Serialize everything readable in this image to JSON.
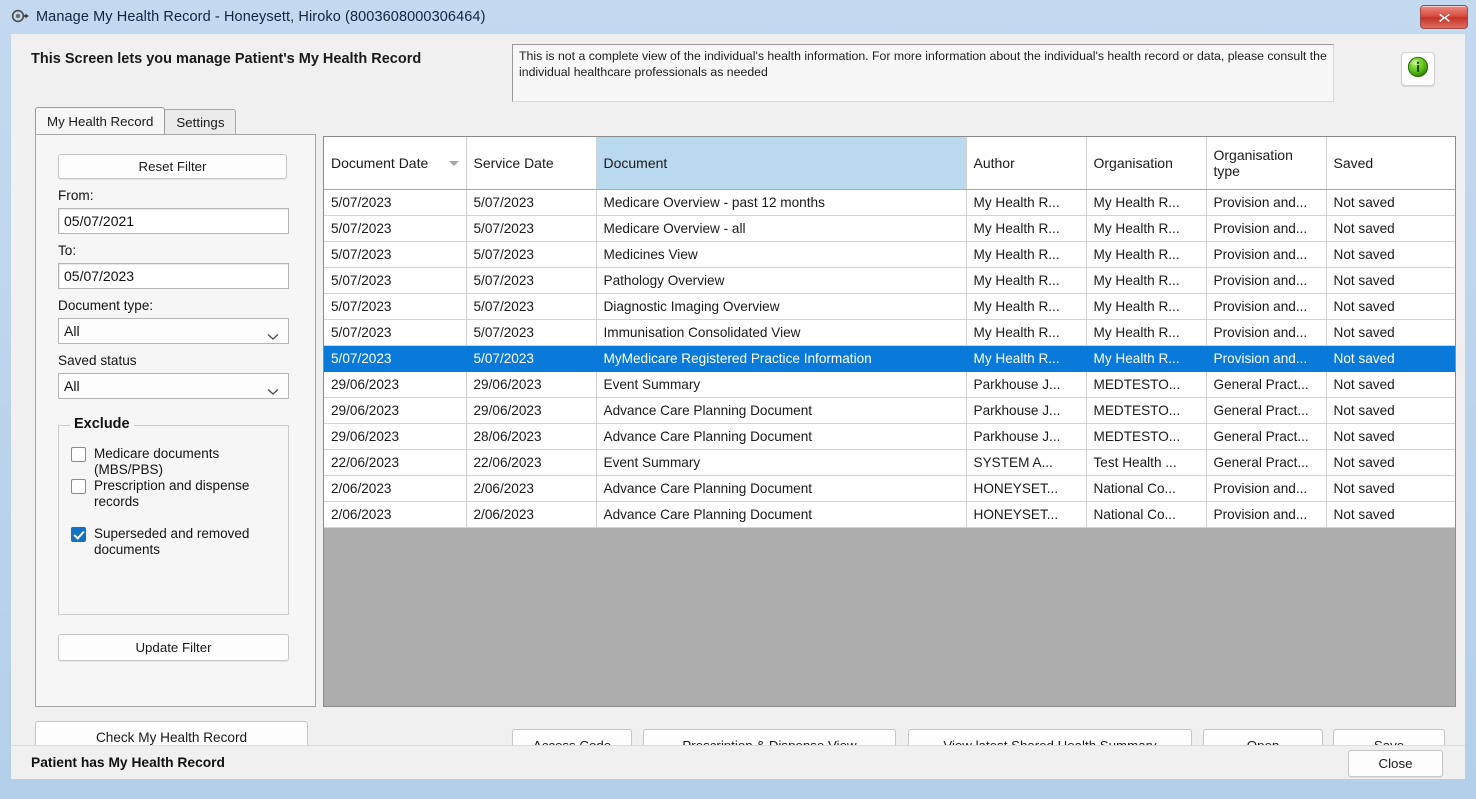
{
  "window": {
    "title": "Manage My Health Record - Honeysett, Hiroko (8003608000306464)",
    "icon": "record-scope-icon",
    "close_icon": "close-icon"
  },
  "header": {
    "headline": "This Screen lets you manage Patient's My Health Record",
    "disclaimer": "This is not a complete view of the individual's health information. For more information about the individual's health record or data, please consult the individual healthcare professionals as needed",
    "info_icon": "info-icon"
  },
  "tabs": [
    {
      "label": "My Health Record",
      "active": true
    },
    {
      "label": "Settings",
      "active": false
    }
  ],
  "filter": {
    "reset_label": "Reset Filter",
    "from_label": "From:",
    "from_value": "05/07/2021",
    "to_label": "To:",
    "to_value": "05/07/2023",
    "doctype_label": "Document type:",
    "doctype_value": "All",
    "saved_status_label": "Saved status",
    "saved_status_value": "All",
    "exclude_legend": "Exclude",
    "exclude_items": [
      {
        "label": "Medicare documents (MBS/PBS)",
        "checked": false
      },
      {
        "label": "Prescription and dispense records",
        "checked": false
      },
      {
        "label": "Superseded and removed documents",
        "checked": true
      }
    ],
    "update_label": "Update Filter",
    "check_mhr_label": "Check My Health Record"
  },
  "grid": {
    "columns": [
      {
        "label": "Document Date",
        "sorted": true,
        "highlight": false
      },
      {
        "label": "Service Date",
        "sorted": false,
        "highlight": false
      },
      {
        "label": "Document",
        "sorted": false,
        "highlight": true
      },
      {
        "label": "Author",
        "sorted": false,
        "highlight": false
      },
      {
        "label": "Organisation",
        "sorted": false,
        "highlight": false
      },
      {
        "label": "Organisation type",
        "sorted": false,
        "highlight": false
      },
      {
        "label": "Saved",
        "sorted": false,
        "highlight": false
      }
    ],
    "rows": [
      {
        "selected": false,
        "cells": [
          "5/07/2023",
          "5/07/2023",
          "Medicare Overview - past 12 months",
          "My Health R...",
          "My Health R...",
          "Provision and...",
          "Not saved"
        ]
      },
      {
        "selected": false,
        "cells": [
          "5/07/2023",
          "5/07/2023",
          "Medicare Overview - all",
          "My Health R...",
          "My Health R...",
          "Provision and...",
          "Not saved"
        ]
      },
      {
        "selected": false,
        "cells": [
          "5/07/2023",
          "5/07/2023",
          "Medicines View",
          "My Health R...",
          "My Health R...",
          "Provision and...",
          "Not saved"
        ]
      },
      {
        "selected": false,
        "cells": [
          "5/07/2023",
          "5/07/2023",
          "Pathology Overview",
          "My Health R...",
          "My Health R...",
          "Provision and...",
          "Not saved"
        ]
      },
      {
        "selected": false,
        "cells": [
          "5/07/2023",
          "5/07/2023",
          "Diagnostic Imaging Overview",
          "My Health R...",
          "My Health R...",
          "Provision and...",
          "Not saved"
        ]
      },
      {
        "selected": false,
        "cells": [
          "5/07/2023",
          "5/07/2023",
          "Immunisation Consolidated View",
          "My Health R...",
          "My Health R...",
          "Provision and...",
          "Not saved"
        ]
      },
      {
        "selected": true,
        "cells": [
          "5/07/2023",
          "5/07/2023",
          "MyMedicare Registered Practice Information",
          "My Health R...",
          "My Health R...",
          "Provision and...",
          "Not saved"
        ]
      },
      {
        "selected": false,
        "cells": [
          "29/06/2023",
          "29/06/2023",
          "Event Summary",
          "Parkhouse J...",
          "MEDTESTO...",
          "General Pract...",
          "Not saved"
        ]
      },
      {
        "selected": false,
        "cells": [
          "29/06/2023",
          "29/06/2023",
          "Advance Care Planning Document",
          "Parkhouse J...",
          "MEDTESTO...",
          "General Pract...",
          "Not saved"
        ]
      },
      {
        "selected": false,
        "cells": [
          "29/06/2023",
          "28/06/2023",
          "Advance Care Planning Document",
          "Parkhouse J...",
          "MEDTESTO...",
          "General Pract...",
          "Not saved"
        ]
      },
      {
        "selected": false,
        "cells": [
          "22/06/2023",
          "22/06/2023",
          "Event Summary",
          "SYSTEM A...",
          "Test Health ...",
          "General Pract...",
          "Not saved"
        ]
      },
      {
        "selected": false,
        "cells": [
          "2/06/2023",
          "2/06/2023",
          "Advance Care Planning Document",
          "HONEYSET...",
          "National Co...",
          "Provision and...",
          "Not saved"
        ]
      },
      {
        "selected": false,
        "cells": [
          "2/06/2023",
          "2/06/2023",
          "Advance Care Planning Document",
          "HONEYSET...",
          "National Co...",
          "Provision and...",
          "Not saved"
        ]
      }
    ]
  },
  "actions": {
    "access_code": "Access Code",
    "prescription_dispense_view": "Prescription & Dispense View",
    "view_latest_shs": "View latest Shared Health Summary",
    "open": "Open",
    "save": "Save"
  },
  "statusbar": {
    "text": "Patient has My Health Record",
    "close_label": "Close"
  },
  "colors": {
    "selection_blue": "#0a7ada",
    "column_highlight": "#b9d9ee",
    "checkbox_checked": "#1173c4",
    "grid_empty": "#adadad",
    "window_chrome": "#b4cfe9"
  }
}
